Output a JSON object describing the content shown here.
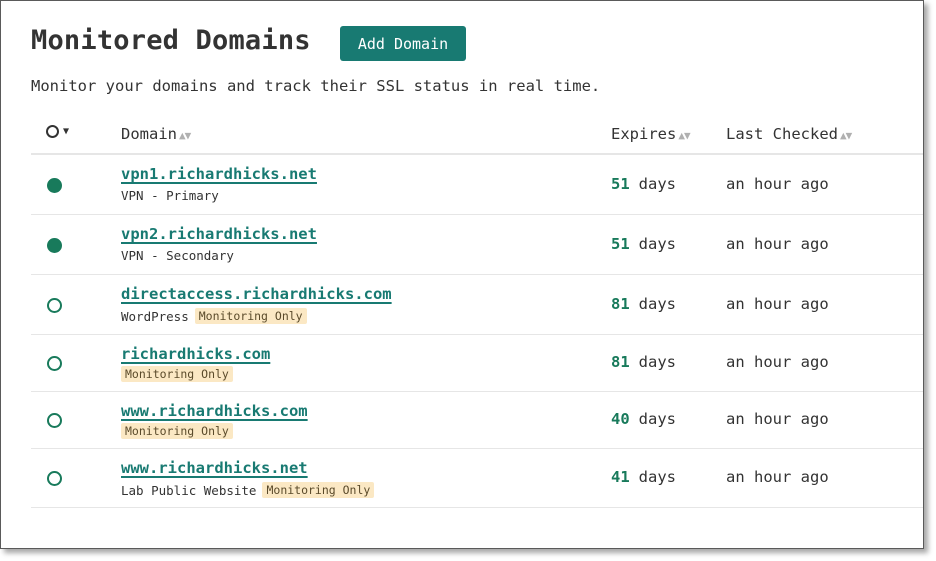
{
  "page": {
    "title": "Monitored Domains",
    "add_button": "Add Domain",
    "subtitle": "Monitor your domains and track their SSL status in real time."
  },
  "table": {
    "headers": {
      "status_sort": "▼",
      "domain": "Domain",
      "expires": "Expires",
      "last_checked": "Last Checked",
      "sort_icon": "▲▼"
    },
    "rows": [
      {
        "status": "active",
        "domain": "vpn1.richardhicks.net",
        "description": "VPN - Primary",
        "badge": "",
        "expires_days": "51",
        "expires_unit": "days",
        "last_checked": "an hour ago"
      },
      {
        "status": "active",
        "domain": "vpn2.richardhicks.net",
        "description": "VPN - Secondary",
        "badge": "",
        "expires_days": "51",
        "expires_unit": "days",
        "last_checked": "an hour ago"
      },
      {
        "status": "inactive",
        "domain": "directaccess.richardhicks.com",
        "description": "WordPress",
        "badge": "Monitoring Only",
        "expires_days": "81",
        "expires_unit": "days",
        "last_checked": "an hour ago"
      },
      {
        "status": "inactive",
        "domain": "richardhicks.com",
        "description": "",
        "badge": "Monitoring Only",
        "expires_days": "81",
        "expires_unit": "days",
        "last_checked": "an hour ago"
      },
      {
        "status": "inactive",
        "domain": "www.richardhicks.com",
        "description": "",
        "badge": "Monitoring Only",
        "expires_days": "40",
        "expires_unit": "days",
        "last_checked": "an hour ago"
      },
      {
        "status": "inactive",
        "domain": "www.richardhicks.net",
        "description": "Lab Public Website",
        "badge": "Monitoring Only",
        "expires_days": "41",
        "expires_unit": "days",
        "last_checked": "an hour ago"
      }
    ]
  },
  "colors": {
    "accent": "#187a72",
    "status_green": "#187a5b",
    "badge_bg": "#fbe8c4"
  }
}
